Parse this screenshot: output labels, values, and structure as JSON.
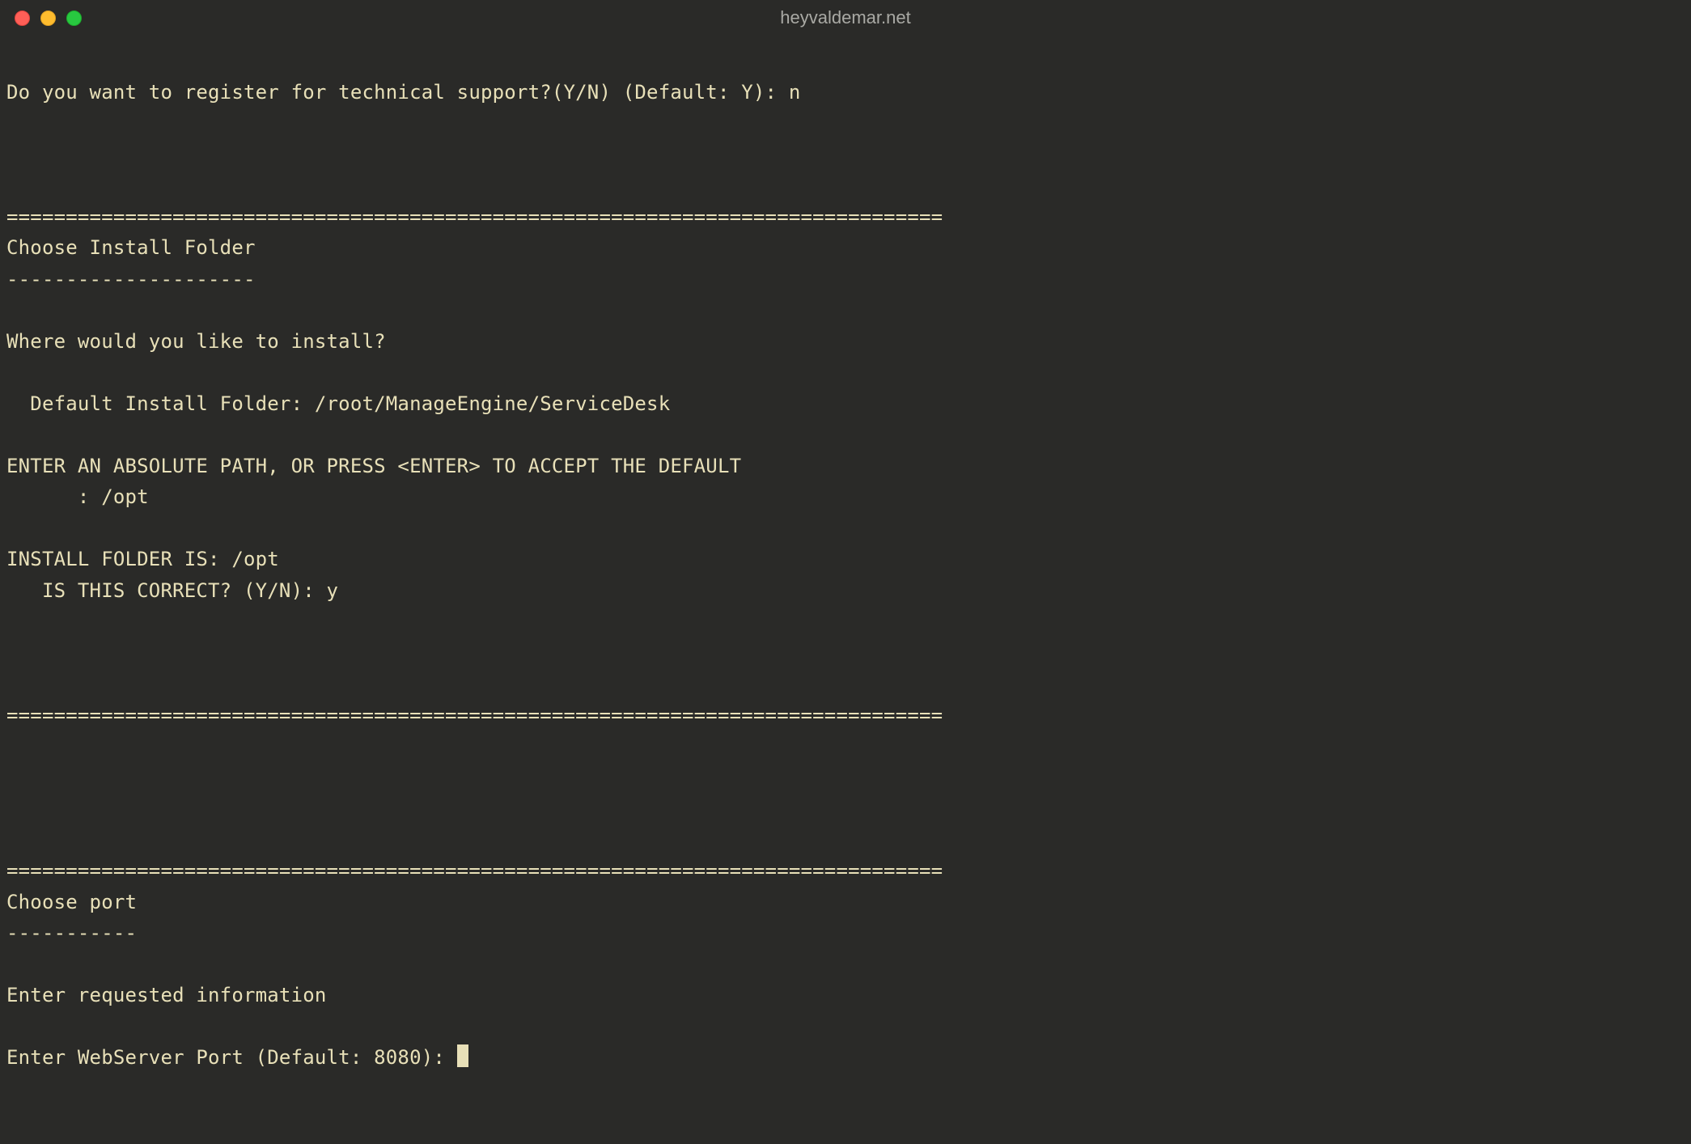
{
  "window": {
    "title": "heyvaldemar.net"
  },
  "terminal": {
    "lines": {
      "l0": "",
      "l1": "Do you want to register for technical support?(Y/N) (Default: Y): n",
      "l2": "",
      "l3": "",
      "l4": "",
      "l5": "===============================================================================",
      "l6": "Choose Install Folder",
      "l7": "---------------------",
      "l8": "",
      "l9": "Where would you like to install?",
      "l10": "",
      "l11": "  Default Install Folder: /root/ManageEngine/ServiceDesk",
      "l12": "",
      "l13": "ENTER AN ABSOLUTE PATH, OR PRESS <ENTER> TO ACCEPT THE DEFAULT",
      "l14": "      : /opt",
      "l15": "",
      "l16": "INSTALL FOLDER IS: /opt",
      "l17": "   IS THIS CORRECT? (Y/N): y",
      "l18": "",
      "l19": "",
      "l20": "",
      "l21": "===============================================================================",
      "l22": "",
      "l23": "",
      "l24": "",
      "l25": "",
      "l26": "===============================================================================",
      "l27": "Choose port",
      "l28": "-----------",
      "l29": "",
      "l30": "Enter requested information",
      "l31": "",
      "l32": "Enter WebServer Port (Default: 8080): "
    }
  }
}
